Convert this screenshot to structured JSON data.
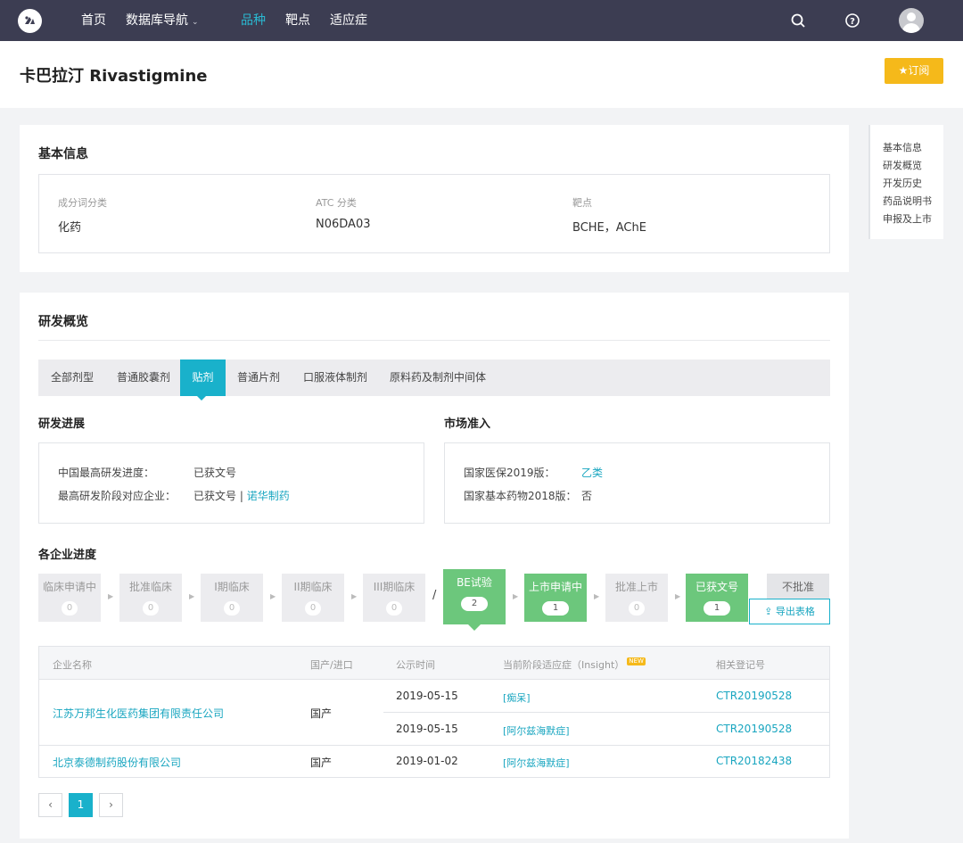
{
  "nav": {
    "items": [
      "首页",
      "数据库导航",
      "品种",
      "靶点",
      "适应症"
    ],
    "active": "品种"
  },
  "header": {
    "title": "卡巴拉汀 Rivastigmine",
    "subscribe": "订阅"
  },
  "side_nav": [
    "基本信息",
    "研发概览",
    "开发历史",
    "药品说明书",
    "申报及上市"
  ],
  "basic_info": {
    "title": "基本信息",
    "fields": [
      {
        "label": "成分词分类",
        "value": "化药"
      },
      {
        "label": "ATC 分类",
        "value": "N06DA03"
      },
      {
        "label": "靶点",
        "value": "BCHE，AChE"
      }
    ]
  },
  "rd_overview": {
    "title": "研发概览",
    "tabs": [
      "全部剂型",
      "普通胶囊剂",
      "贴剂",
      "普通片剂",
      "口服液体制剂",
      "原料药及制剂中间体"
    ],
    "active_tab": "贴剂",
    "progress": {
      "title": "研发进展",
      "rows": [
        {
          "label": "中国最高研发进度：",
          "value": "已获文号"
        },
        {
          "label": "最高研发阶段对应企业：",
          "value": "已获文号 |",
          "link": "诺华制药"
        }
      ]
    },
    "market": {
      "title": "市场准入",
      "rows": [
        {
          "label": "国家医保2019版：",
          "link": "乙类"
        },
        {
          "label": "国家基本药物2018版：",
          "value": "否"
        }
      ]
    },
    "company_progress": {
      "title": "各企业进度",
      "stages": [
        {
          "name": "临床申请中",
          "count": "0",
          "state": "gray"
        },
        {
          "name": "批准临床",
          "count": "0",
          "state": "gray"
        },
        {
          "name": "I期临床",
          "count": "0",
          "state": "gray"
        },
        {
          "name": "II期临床",
          "count": "0",
          "state": "gray"
        },
        {
          "name": "III期临床",
          "count": "0",
          "state": "gray"
        },
        {
          "name": "BE试验",
          "count": "2",
          "state": "active"
        },
        {
          "name": "上市申请中",
          "count": "1",
          "state": "green"
        },
        {
          "name": "批准上市",
          "count": "0",
          "state": "gray"
        },
        {
          "name": "已获文号",
          "count": "1",
          "state": "green"
        },
        {
          "name": "不批准",
          "count": "",
          "state": "reject"
        }
      ],
      "separator": "/",
      "export": "导出表格"
    },
    "table": {
      "headers": [
        "企业名称",
        "国产/进口",
        "公示时间",
        "当前阶段适应症（Insight）",
        "NEW",
        "相关登记号"
      ],
      "rows": [
        {
          "company": "江苏万邦生化医药集团有限责任公司",
          "origin": "国产",
          "entries": [
            {
              "date": "2019-05-15",
              "indication": "[痴呆]",
              "reg": "CTR20190528"
            },
            {
              "date": "2019-05-15",
              "indication": "[阿尔兹海默症]",
              "reg": "CTR20190528"
            }
          ]
        },
        {
          "company": "北京泰德制药股份有限公司",
          "origin": "国产",
          "entries": [
            {
              "date": "2019-01-02",
              "indication": "[阿尔兹海默症]",
              "reg": "CTR20182438"
            }
          ]
        }
      ]
    },
    "pagination": {
      "prev": "‹",
      "current": "1",
      "next": "›"
    }
  }
}
